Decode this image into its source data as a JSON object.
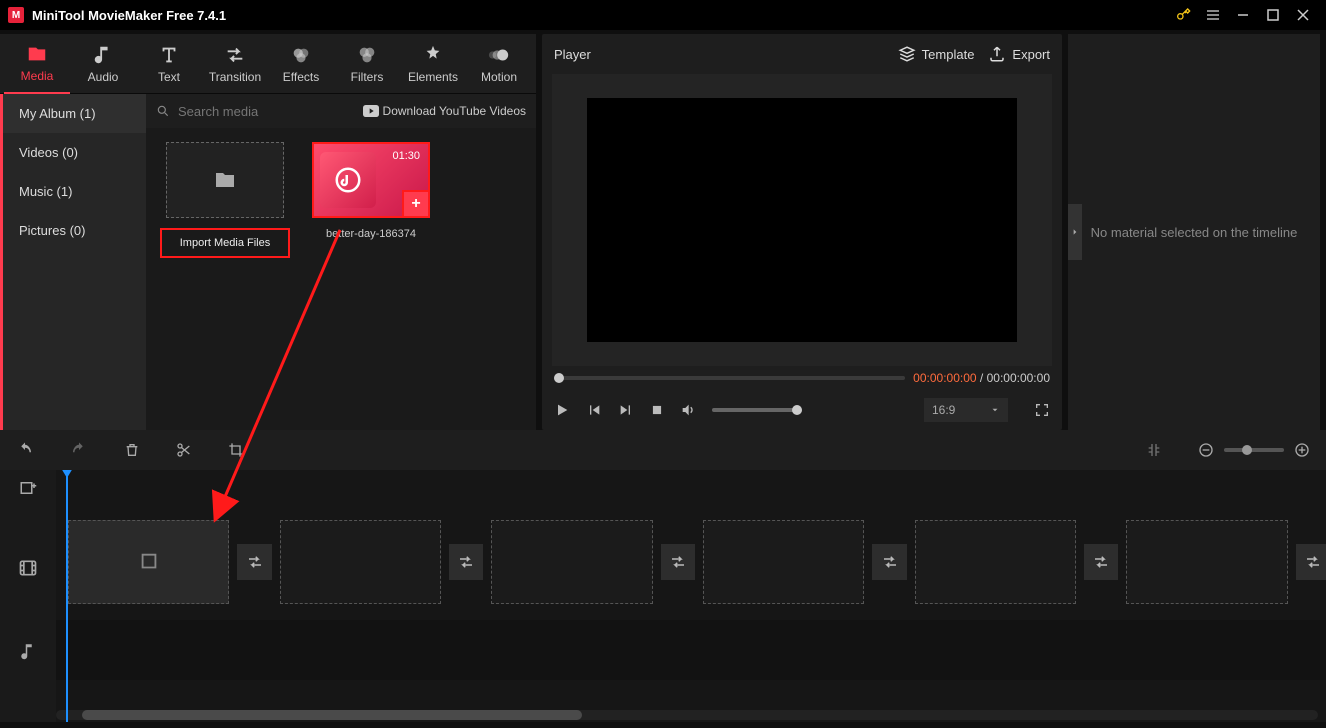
{
  "app": {
    "title": "MiniTool MovieMaker Free 7.4.1"
  },
  "ribbon": {
    "media": "Media",
    "audio": "Audio",
    "text": "Text",
    "transition": "Transition",
    "effects": "Effects",
    "filters": "Filters",
    "elements": "Elements",
    "motion": "Motion"
  },
  "categories": {
    "myalbum": "My Album (1)",
    "videos": "Videos (0)",
    "music": "Music (1)",
    "pictures": "Pictures (0)"
  },
  "search": {
    "placeholder": "Search media",
    "yt": "Download YouTube Videos"
  },
  "media_items": {
    "import_label": "Import Media Files",
    "clip1_name": "better-day-186374",
    "clip1_dur": "01:30"
  },
  "player": {
    "title": "Player",
    "template": "Template",
    "export": "Export",
    "tc_current": "00:00:00:00",
    "tc_sep": " / ",
    "tc_total": "00:00:00:00",
    "aspect": "16:9"
  },
  "right_panel": {
    "empty_msg": "No material selected on the timeline"
  }
}
